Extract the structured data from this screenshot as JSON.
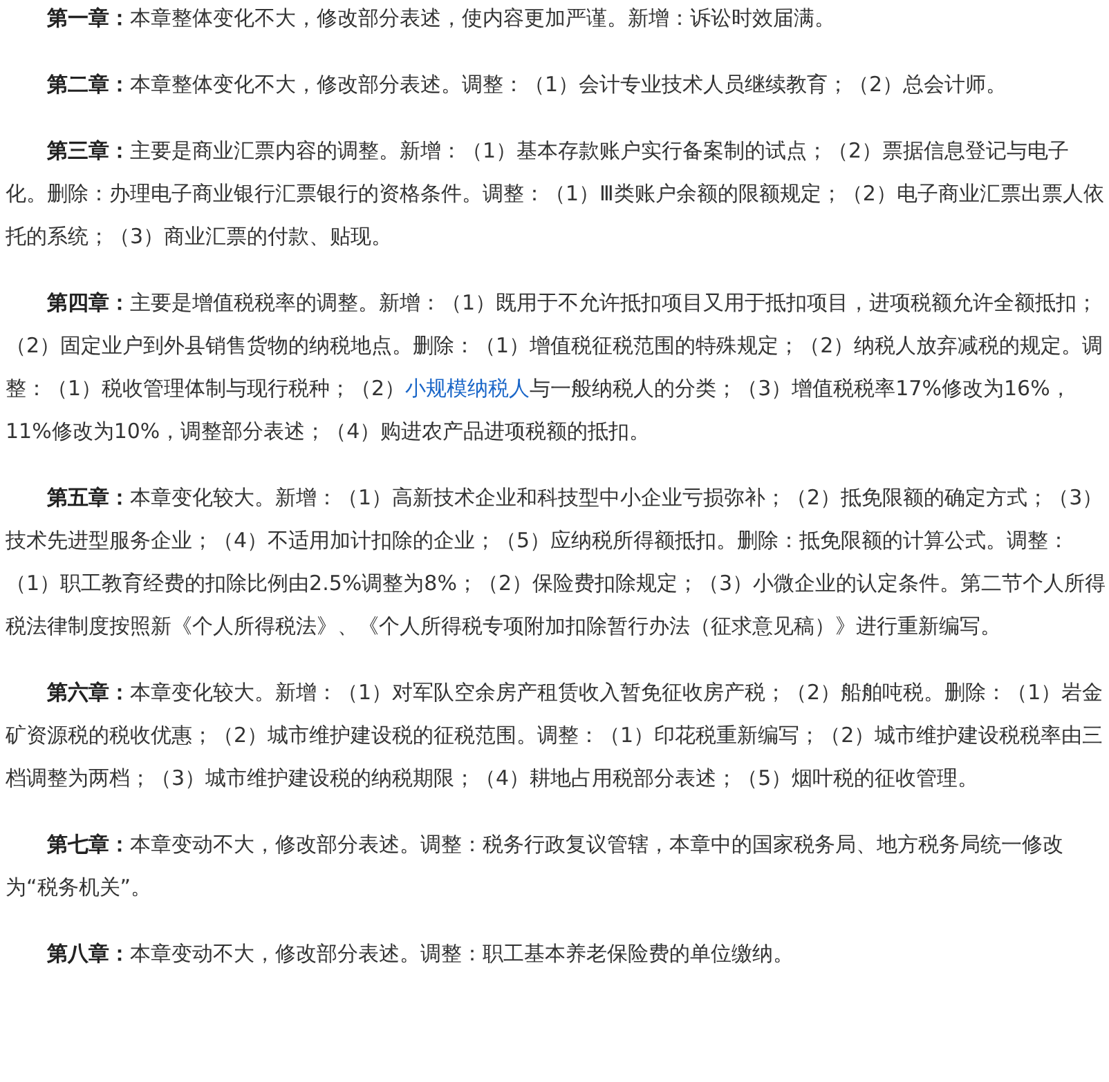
{
  "paragraphs": [
    {
      "segments": [
        {
          "kind": "text",
          "text": "**第一章：**本章整体变化不大，修改部分表述，使内容更加严谨。新增：诉讼时效届满。"
        }
      ]
    },
    {
      "segments": [
        {
          "kind": "text",
          "text": "**第二章：**本章整体变化不大，修改部分表述。调整：（1）会计专业技术人员继续教育；（2）总会计师。"
        }
      ]
    },
    {
      "segments": [
        {
          "kind": "text",
          "text": "**第三章：**主要是商业汇票内容的调整。新增：（1）基本存款账户实行备案制的试点；（2）票据信息登记与电子化。删除：办理电子商业银行汇票银行的资格条件。调整：（1）Ⅲ类账户余额的限额规定；（2）电子商业汇票出票人依托的系统；（3）商业汇票的付款、贴现。"
        }
      ]
    },
    {
      "segments": [
        {
          "kind": "text",
          "text": "**第四章：**主要是增值税税率的调整。新增：（1）既用于不允许抵扣项目又用于抵扣项目，进项税额允许全额抵扣；（2）固定业户到外县销售货物的纳税地点。删除：（1）增值税征税范围的特殊规定；（2）纳税人放弃减税的规定。调整：（1）税收管理体制与现行税种；（2）"
        },
        {
          "kind": "link",
          "text": "小规模纳税人"
        },
        {
          "kind": "text",
          "text": "与一般纳税人的分类；（3）增值税税率17%修改为16%，11%修改为10%，调整部分表述；（4）购进农产品进项税额的抵扣。"
        }
      ]
    },
    {
      "segments": [
        {
          "kind": "text",
          "text": "**第五章：**本章变化较大。新增：（1）高新技术企业和科技型中小企业亏损弥补；（2）抵免限额的确定方式；（3）技术先进型服务企业；（4）不适用加计扣除的企业；（5）应纳税所得额抵扣。删除：抵免限额的计算公式。调整：（1）职工教育经费的扣除比例由2.5%调整为8%；（2）保险费扣除规定；（3）小微企业的认定条件。第二节个人所得税法律制度按照新《个人所得税法》、《个人所得税专项附加扣除暂行办法（征求意见稿）》进行重新编写。"
        }
      ]
    },
    {
      "segments": [
        {
          "kind": "text",
          "text": "**第六章：**本章变化较大。新增：（1）对军队空余房产租赁收入暂免征收房产税；（2）船舶吨税。删除：（1）岩金矿资源税的税收优惠；（2）城市维护建设税的征税范围。调整：（1）印花税重新编写；（2）城市维护建设税税率由三档调整为两档；（3）城市维护建设税的纳税期限；（4）耕地占用税部分表述；（5）烟叶税的征收管理。"
        }
      ]
    },
    {
      "segments": [
        {
          "kind": "text",
          "text": "**第七章：**本章变动不大，修改部分表述。调整：税务行政复议管辖，本章中的国家税务局、地方税务局统一修改为“税务机关”。"
        }
      ]
    },
    {
      "segments": [
        {
          "kind": "text",
          "text": "**第八章：**本章变动不大，修改部分表述。调整：职工基本养老保险费的单位缴纳。"
        }
      ]
    }
  ]
}
